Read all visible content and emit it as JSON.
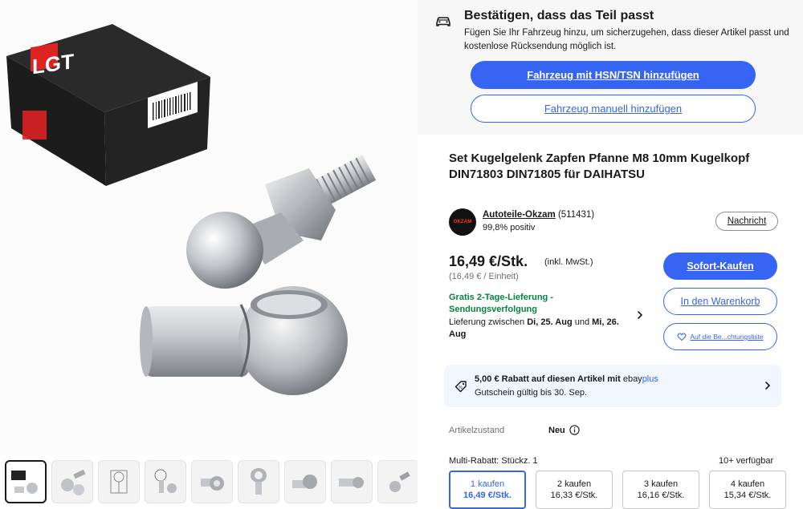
{
  "fit_panel": {
    "icon": "car-icon",
    "title": "Bestätigen, dass das Teil passt",
    "description": "Fügen Sie Ihr Fahrzeug hinzu, um sicherzugehen, dass dieser Artikel passt und kostenlose Rücksendung möglich ist.",
    "primary_button": "Fahrzeug mit HSN/TSN hinzufügen",
    "secondary_button": "Fahrzeug manuell hinzufügen"
  },
  "product": {
    "title": "Set Kugelgelenk Zapfen Pfanne M8 10mm Kugelkopf DIN71803 DIN71805 für DAIHATSU"
  },
  "gallery": {
    "box_logo": "LGT",
    "thumbnail_count": 9,
    "selected_thumbnail": 0
  },
  "seller": {
    "logo_text": "OKZAM",
    "name": "Autoteile-Okzam",
    "feedback_count": "(511431)",
    "rating": "99,8% positiv",
    "message_button": "Nachricht"
  },
  "pricing": {
    "price": "16,49 €/Stk.",
    "price_note": "(inkl. MwSt.)",
    "unit_price": "(16,49 € / Einheit)"
  },
  "shipping": {
    "free_line1": "Gratis 2-Tage-Lieferung -",
    "free_line2": "Sendungsverfolgung",
    "delivery_prefix": "Lieferung zwischen ",
    "delivery_date1": "Di, 25. Aug",
    "delivery_and": " und ",
    "delivery_date2": "Mi, 26. Aug"
  },
  "actions": {
    "buy_now": "Sofort-Kaufen",
    "add_to_cart": "In den Warenkorb",
    "watchlist": "Auf die Be...chtungsliste"
  },
  "promo": {
    "line1": "5,00 € Rabatt auf diesen Artikel mit ",
    "brand_ebay": "ebay",
    "brand_plus": "plus",
    "line2": "Gutschein gültig bis 30. Sep."
  },
  "condition": {
    "label": "Artikelzustand",
    "value": "Neu"
  },
  "multi_buy": {
    "label": "Multi-Rabatt: Stückz. 1",
    "availability": "10+ verfügbar",
    "tiers": [
      {
        "qty": "1 kaufen",
        "price": "16,49 €/Stk."
      },
      {
        "qty": "2 kaufen",
        "price": "16,33 €/Stk."
      },
      {
        "qty": "3 kaufen",
        "price": "16,16 €/Stk."
      },
      {
        "qty": "4 kaufen",
        "price": "15,34 €/Stk."
      }
    ]
  },
  "colors": {
    "primary_blue": "#3665f3",
    "success_green": "#05823f",
    "promo_bg": "#f0f5ff",
    "panel_bg": "#f7f7f7"
  }
}
